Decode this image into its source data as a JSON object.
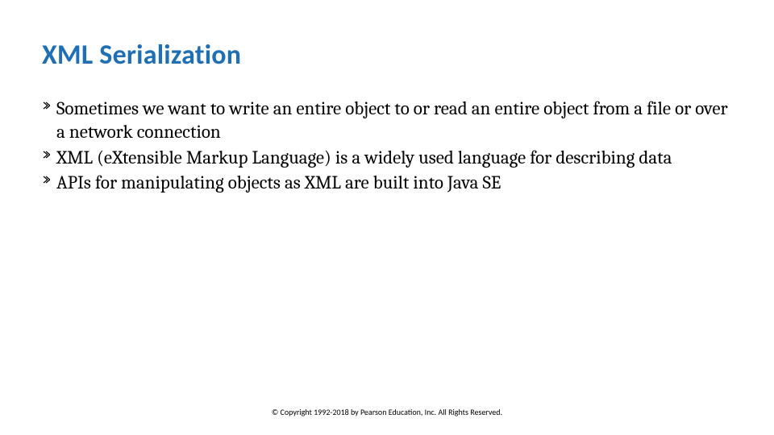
{
  "title": "XML Serialization",
  "bullets": [
    "Sometimes we want to write an entire object to or read an entire object from a file or over a network connection",
    "XML (eXtensible Markup Language) is a widely used language for describing data",
    "APIs for manipulating objects as XML are built into Java SE"
  ],
  "footer": "© Copyright 1992-2018 by Pearson Education, Inc. All Rights Reserved."
}
